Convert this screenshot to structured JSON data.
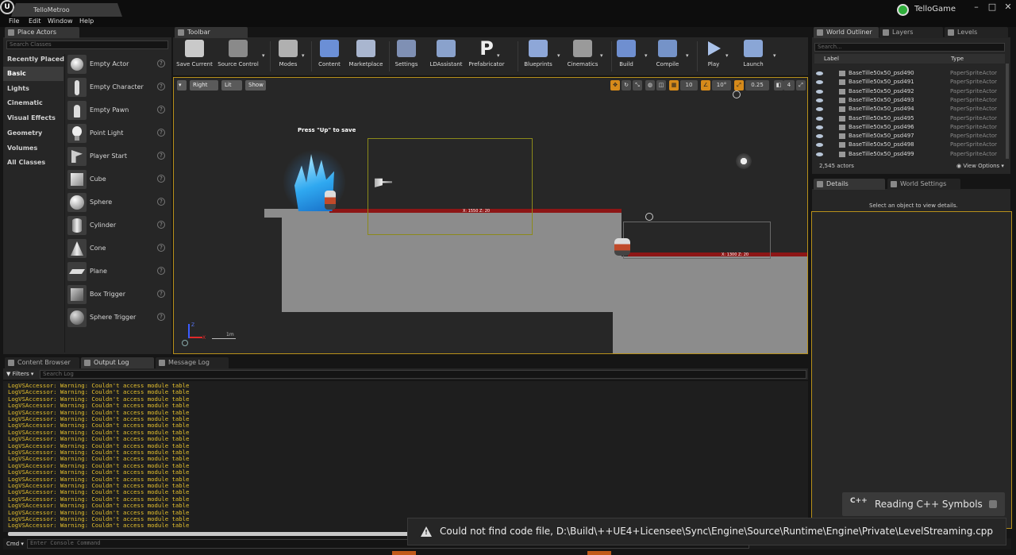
{
  "app": {
    "document_tab": "TelloMetroo",
    "project_name": "TelloGame",
    "engine_logo": "U"
  },
  "window_controls": {
    "minimize": "–",
    "maximize": "□",
    "close": "✕"
  },
  "menu": [
    "File",
    "Edit",
    "Window",
    "Help"
  ],
  "place_actors": {
    "tab_label": "Place Actors",
    "search_placeholder": "Search Classes",
    "categories": [
      "Recently Placed",
      "Basic",
      "Lights",
      "Cinematic",
      "Visual Effects",
      "Geometry",
      "Volumes",
      "All Classes"
    ],
    "selected_category": "Basic",
    "actors": [
      "Empty Actor",
      "Empty Character",
      "Empty Pawn",
      "Point Light",
      "Player Start",
      "Cube",
      "Sphere",
      "Cylinder",
      "Cone",
      "Plane",
      "Box Trigger",
      "Sphere Trigger"
    ],
    "help_glyph": "?"
  },
  "toolbar": {
    "tab_label": "Toolbar",
    "buttons": [
      {
        "label": "Save Current",
        "color": "#c9c9c9"
      },
      {
        "label": "Source Control",
        "color": "#8a8a8a"
      },
      {
        "label": "Modes",
        "color": "#b0b0b0"
      },
      {
        "label": "Content",
        "color": "#6b8fd6"
      },
      {
        "label": "Marketplace",
        "color": "#a9b6cf"
      },
      {
        "label": "Settings",
        "color": "#7f90b4"
      },
      {
        "label": "LDAssistant",
        "color": "#8aa2cc"
      },
      {
        "label": "Prefabricator",
        "color": "#eeeeee"
      },
      {
        "label": "Blueprints",
        "color": "#8ea7d8"
      },
      {
        "label": "Cinematics",
        "color": "#9a9a9a"
      },
      {
        "label": "Build",
        "color": "#6f8fd0"
      },
      {
        "label": "Compile",
        "color": "#7593c8"
      },
      {
        "label": "Play",
        "color": "#aac2ea"
      },
      {
        "label": "Launch",
        "color": "#8aa6d6"
      }
    ],
    "prefab_letter": "P"
  },
  "viewport": {
    "view_buttons": [
      "Right",
      "Lit",
      "Show"
    ],
    "snap_values": [
      "10",
      "10°",
      "0.25",
      "4"
    ],
    "hint_text": "Press \"Up\" to save",
    "bar_label_1": "X: 1550 Z: 20",
    "bar_label_2": "X: 1300 Z: 20",
    "scale_label": "1m",
    "axis_labels": {
      "z": "Z",
      "x": "X"
    }
  },
  "world_outliner": {
    "tabs": [
      "World Outliner",
      "Layers",
      "Levels"
    ],
    "search_placeholder": "Search...",
    "columns": [
      "Label",
      "Type"
    ],
    "rows": [
      {
        "name": "BaseTille50x50_psd490",
        "type": "PaperSpriteActor"
      },
      {
        "name": "BaseTille50x50_psd491",
        "type": "PaperSpriteActor"
      },
      {
        "name": "BaseTille50x50_psd492",
        "type": "PaperSpriteActor"
      },
      {
        "name": "BaseTille50x50_psd493",
        "type": "PaperSpriteActor"
      },
      {
        "name": "BaseTille50x50_psd494",
        "type": "PaperSpriteActor"
      },
      {
        "name": "BaseTille50x50_psd495",
        "type": "PaperSpriteActor"
      },
      {
        "name": "BaseTille50x50_psd496",
        "type": "PaperSpriteActor"
      },
      {
        "name": "BaseTille50x50_psd497",
        "type": "PaperSpriteActor"
      },
      {
        "name": "BaseTille50x50_psd498",
        "type": "PaperSpriteActor"
      },
      {
        "name": "BaseTille50x50_psd499",
        "type": "PaperSpriteActor"
      }
    ],
    "actor_count": "2,545 actors",
    "view_options": "View Options"
  },
  "details": {
    "tabs": [
      "Details",
      "World Settings"
    ],
    "empty_text": "Select an object to view details."
  },
  "bottom_tabs": [
    "Content Browser",
    "Output Log",
    "Message Log"
  ],
  "output_log": {
    "filters_label": "Filters",
    "search_placeholder": "Search Log",
    "line_text": "LogVSAccessor: Warning: Couldn't access module table",
    "line_count": 22
  },
  "console": {
    "cmd_label": "Cmd",
    "placeholder": "Enter Console Command"
  },
  "notifications": {
    "symbols_icon": "C++",
    "symbols_text": "Reading C++ Symbols",
    "error_icon": "!",
    "error_text": "Could not find code file, D:\\Build\\++UE4+Licensee\\Sync\\Engine\\Source\\Runtime\\Engine\\Private\\LevelStreaming.cpp"
  },
  "colors": {
    "accent": "#d68a1a",
    "log_warning": "#e6c12e",
    "platform_red": "#8d1616"
  }
}
